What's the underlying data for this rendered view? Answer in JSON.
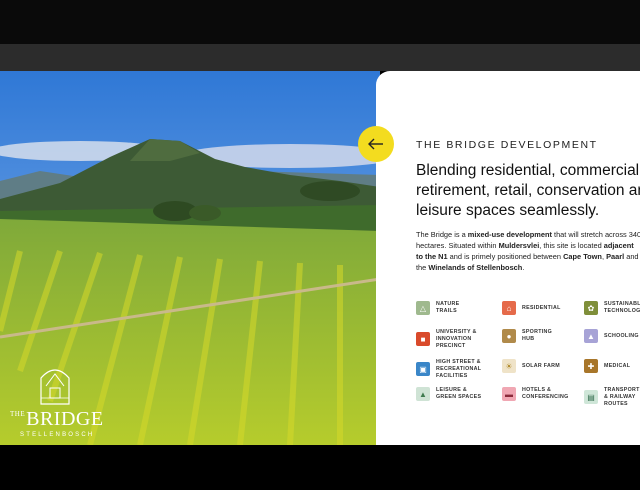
{
  "hero": {
    "logo": {
      "the": "THE",
      "title": "BRIDGE",
      "subtitle": "STELLENBOSCH"
    }
  },
  "panel": {
    "eyebrow": "THE BRIDGE DEVELOPMENT",
    "headline": "Blending residential, commercial, retirement, retail, conservation and leisure spaces seamlessly.",
    "body": {
      "p1": "The Bridge is a ",
      "b1": "mixed-use development",
      "p2": " that will stretch across 340 hectares. Situated within ",
      "b2": "Muldersvlei",
      "p3": ", this site is located ",
      "b3": "adjacent to the N1",
      "p4": " and is primely positioned between ",
      "b4": "Cape Town",
      "p5": ", ",
      "b5": "Paarl",
      "p6": " and the ",
      "b6": "Winelands of Stellenbosch",
      "p7": "."
    },
    "back_button_icon": "arrow-left-icon"
  },
  "features": [
    {
      "label": "NATURE\nTRAILS",
      "icon": "hiker-icon",
      "color": "#9fb98e"
    },
    {
      "label": "RESIDENTIAL",
      "icon": "house-icon",
      "color": "#e56a4a"
    },
    {
      "label": "SUSTAINABLE\nTECHNOLOGY",
      "icon": "leaf-icon",
      "color": "#7f8f3a"
    },
    {
      "label": "UNIVERSITY &\nINNOVATION\nPRECINCT",
      "icon": "university-icon",
      "color": "#d94a2b"
    },
    {
      "label": "SPORTING\nHUB",
      "icon": "ball-icon",
      "color": "#b08a4a"
    },
    {
      "label": "SCHOOLING",
      "icon": "grad-cap-icon",
      "color": "#a7a3d6"
    },
    {
      "label": "HIGH STREET &\nRECREATIONAL\nFACILITIES",
      "icon": "cart-icon",
      "color": "#3a86c8"
    },
    {
      "label": "SOLAR FARM",
      "icon": "sun-icon",
      "color": "#efe3c8"
    },
    {
      "label": "MEDICAL",
      "icon": "stethoscope-icon",
      "color": "#a8762a"
    },
    {
      "label": "LEISURE &\nGREEN SPACES",
      "icon": "tree-icon",
      "color": "#cfe3d5"
    },
    {
      "label": "HOTELS &\nCONFERENCING",
      "icon": "bed-icon",
      "color": "#f0a7b3"
    },
    {
      "label": "TRANSPORT\n& RAILWAY\nROUTES",
      "icon": "train-icon",
      "color": "#cfe6d8"
    }
  ]
}
